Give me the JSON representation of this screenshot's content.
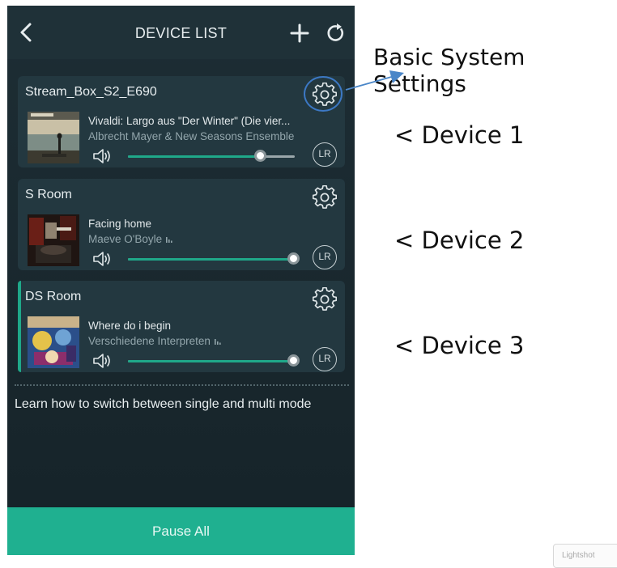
{
  "header": {
    "title": "DEVICE LIST",
    "back_icon": "chevron-left-icon",
    "add_icon": "plus-icon",
    "refresh_icon": "refresh-icon"
  },
  "devices": [
    {
      "name": "Stream_Box_S2_E690",
      "track": "Vivaldi: Largo aus \"Der Winter\" (Die vier...",
      "artist": "Albrecht Mayer & New Seasons Ensemble",
      "volume": 0.79,
      "channel_label": "LR",
      "active": false
    },
    {
      "name": "S Room",
      "track": "Facing home",
      "artist": "Maeve O'Boyle",
      "volume": 0.99,
      "channel_label": "LR",
      "active": false
    },
    {
      "name": "DS Room",
      "track": "Where do i begin",
      "artist": "Verschiedene Interpreten",
      "volume": 0.99,
      "channel_label": "LR",
      "active": true
    }
  ],
  "learn_link": "Learn how to switch between single and multi mode",
  "pause_all_label": "Pause All",
  "annotations": {
    "settings": "Basic System Settings",
    "device1": "< Device 1",
    "device2": "< Device 2",
    "device3": "< Device 3"
  },
  "corner_text": "Lightshot",
  "colors": {
    "accent": "#1fb090",
    "background": "#1c2c33",
    "card": "#233840",
    "highlight_ring": "#3c78c4"
  }
}
